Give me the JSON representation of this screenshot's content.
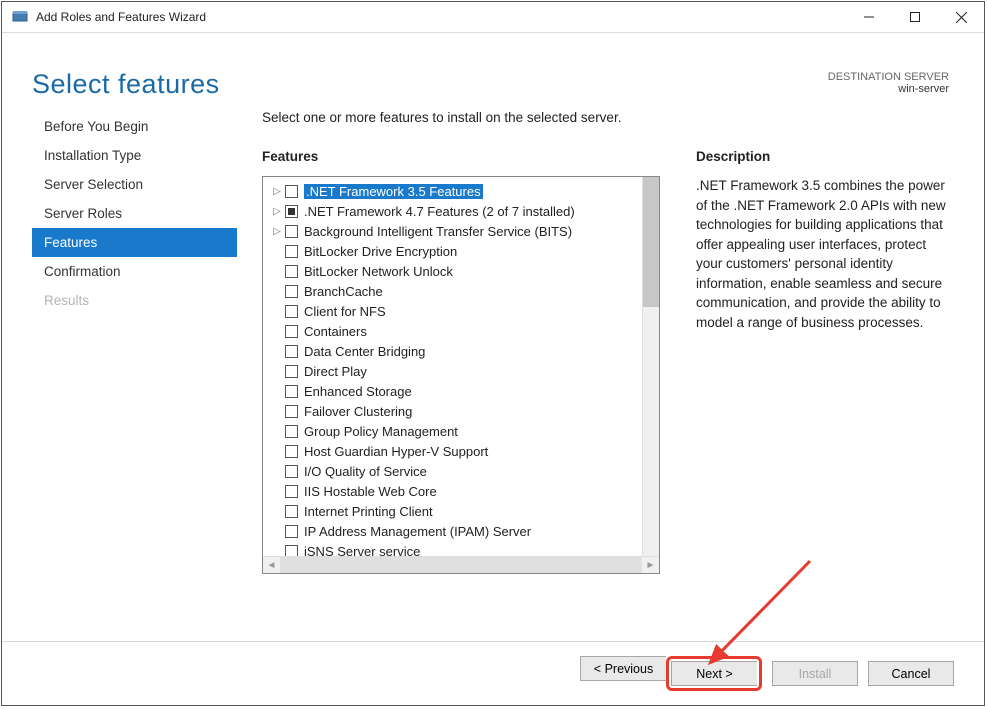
{
  "window": {
    "title": "Add Roles and Features Wizard"
  },
  "page": {
    "title": "Select features"
  },
  "destination": {
    "label": "DESTINATION SERVER",
    "name": "win-server"
  },
  "sidebar": [
    {
      "label": "Before You Begin",
      "state": "normal"
    },
    {
      "label": "Installation Type",
      "state": "normal"
    },
    {
      "label": "Server Selection",
      "state": "normal"
    },
    {
      "label": "Server Roles",
      "state": "normal"
    },
    {
      "label": "Features",
      "state": "selected"
    },
    {
      "label": "Confirmation",
      "state": "normal"
    },
    {
      "label": "Results",
      "state": "disabled"
    }
  ],
  "instruction": "Select one or more features to install on the selected server.",
  "featuresLabel": "Features",
  "descriptionLabel": "Description",
  "descriptionText": ".NET Framework 3.5 combines the power of the .NET Framework 2.0 APIs with new technologies for building applications that offer appealing user interfaces, protect your customers' personal identity information, enable seamless and secure communication, and provide the ability to model a range of business processes.",
  "features": [
    {
      "label": ".NET Framework 3.5 Features",
      "expandable": true,
      "check": "empty",
      "selected": true
    },
    {
      "label": ".NET Framework 4.7 Features (2 of 7 installed)",
      "expandable": true,
      "check": "square"
    },
    {
      "label": "Background Intelligent Transfer Service (BITS)",
      "expandable": true,
      "check": "empty"
    },
    {
      "label": "BitLocker Drive Encryption",
      "expandable": false,
      "check": "empty"
    },
    {
      "label": "BitLocker Network Unlock",
      "expandable": false,
      "check": "empty"
    },
    {
      "label": "BranchCache",
      "expandable": false,
      "check": "empty"
    },
    {
      "label": "Client for NFS",
      "expandable": false,
      "check": "empty"
    },
    {
      "label": "Containers",
      "expandable": false,
      "check": "empty"
    },
    {
      "label": "Data Center Bridging",
      "expandable": false,
      "check": "empty"
    },
    {
      "label": "Direct Play",
      "expandable": false,
      "check": "empty"
    },
    {
      "label": "Enhanced Storage",
      "expandable": false,
      "check": "empty"
    },
    {
      "label": "Failover Clustering",
      "expandable": false,
      "check": "empty"
    },
    {
      "label": "Group Policy Management",
      "expandable": false,
      "check": "empty"
    },
    {
      "label": "Host Guardian Hyper-V Support",
      "expandable": false,
      "check": "empty"
    },
    {
      "label": "I/O Quality of Service",
      "expandable": false,
      "check": "empty"
    },
    {
      "label": "IIS Hostable Web Core",
      "expandable": false,
      "check": "empty"
    },
    {
      "label": "Internet Printing Client",
      "expandable": false,
      "check": "empty"
    },
    {
      "label": "IP Address Management (IPAM) Server",
      "expandable": false,
      "check": "empty"
    },
    {
      "label": "iSNS Server service",
      "expandable": false,
      "check": "empty"
    }
  ],
  "buttons": {
    "previous": "< Previous",
    "next": "Next >",
    "install": "Install",
    "cancel": "Cancel"
  }
}
